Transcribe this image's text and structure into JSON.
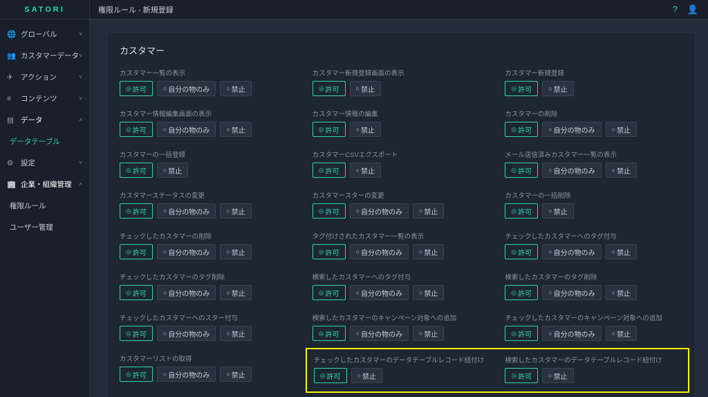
{
  "app": {
    "logo": "SATORI"
  },
  "breadcrumb": "権限ルール - 新規登録",
  "sidebar": {
    "items": [
      {
        "label": "グローバル",
        "icon": "🌐",
        "expand": "˅"
      },
      {
        "label": "カスタマーデータ",
        "icon": "👥",
        "expand": "˅"
      },
      {
        "label": "アクション",
        "icon": "✈",
        "expand": "˅"
      },
      {
        "label": "コンテンツ",
        "icon": "≡",
        "expand": "˅"
      },
      {
        "label": "データ",
        "icon": "▤",
        "expand": "˄"
      },
      {
        "label": "データテーブル",
        "icon": ""
      },
      {
        "label": "設定",
        "icon": "⚙",
        "expand": "˅"
      },
      {
        "label": "企業・組織管理",
        "icon": "🏢",
        "expand": "˄"
      },
      {
        "label": "権限ルール",
        "icon": ""
      },
      {
        "label": "ユーザー管理",
        "icon": ""
      }
    ]
  },
  "panel": {
    "title": "カスタマー"
  },
  "opt": {
    "allow": "許可",
    "own": "自分の物のみ",
    "deny": "禁止"
  },
  "perms": {
    "r0c0": "カスタマー一覧の表示",
    "r0c1": "カスタマー新規登録画面の表示",
    "r0c2": "カスタマー新規登録",
    "r1c0": "カスタマー情報編集画面の表示",
    "r1c1": "カスタマー情報の編集",
    "r1c2": "カスタマーの削除",
    "r2c0": "カスタマーの一括登録",
    "r2c1": "カスタマーCSVエクスポート",
    "r2c2": "メール送信済みカスタマー一覧の表示",
    "r3c0": "カスタマーステータスの変更",
    "r3c1": "カスタマースターの変更",
    "r3c2": "カスタマーの一括削除",
    "r4c0": "チェックしたカスタマーの削除",
    "r4c1": "タグ付けされたカスタマー一覧の表示",
    "r4c2": "チェックしたカスタマーへのタグ付与",
    "r5c0": "チェックしたカスタマーのタグ削除",
    "r5c1": "検索したカスタマーへのタグ付与",
    "r5c2": "検索したカスタマーのタグ削除",
    "r6c0": "チェックしたカスタマーへのスター付与",
    "r6c1": "検索したカスタマーのキャンペーン対象への追加",
    "r6c2": "チェックしたカスタマーのキャンペーン対象への追加",
    "r7c0": "カスタマーリストの取得",
    "r7c1": "チェックしたカスタマーのデータテーブルレコード紐付け",
    "r7c2": "検索したカスタマーのデータテーブルレコード紐付け"
  }
}
